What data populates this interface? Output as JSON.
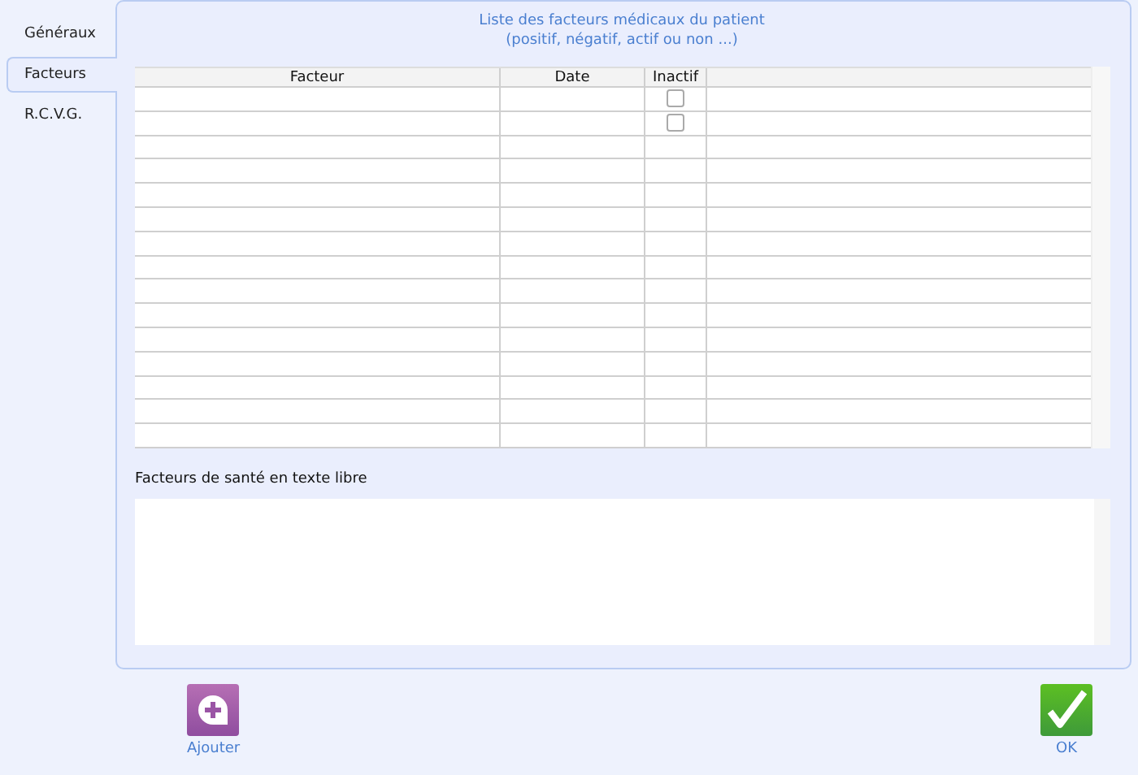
{
  "tabs": [
    {
      "label": "Généraux",
      "selected": false
    },
    {
      "label": "Facteurs",
      "selected": true
    },
    {
      "label": "R.C.V.G.",
      "selected": false
    }
  ],
  "panel": {
    "title": "Liste des facteurs médicaux du patient",
    "subtitle": "(positif, négatif, actif ou non ...)"
  },
  "table": {
    "columns": [
      "Facteur",
      "Date",
      "Inactif"
    ],
    "rows": [
      {
        "inactive": false
      },
      {
        "inactive": false
      }
    ]
  },
  "free_text": {
    "label": "Facteurs de santé en texte libre"
  },
  "buttons": [
    {
      "kind": "add",
      "label": "Ajouter"
    },
    {
      "kind": "ok",
      "label": "OK"
    }
  ]
}
